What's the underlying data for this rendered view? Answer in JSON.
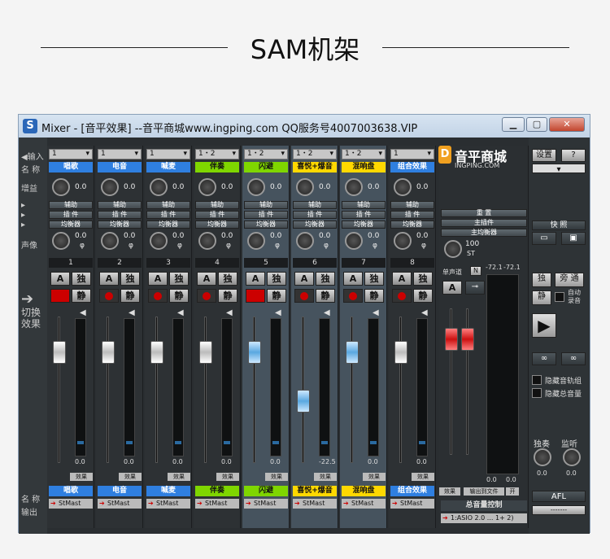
{
  "page": {
    "title": "SAM机架"
  },
  "window": {
    "title": "Mixer - [音平效果] --音平商城www.ingping.com QQ服务号4007003638.VIP",
    "app_icon": "S",
    "btn_min": "▁",
    "btn_max": "▢",
    "btn_close": "✕"
  },
  "rows": {
    "input": "◀输入",
    "name": "名 称",
    "gain": "增益",
    "pan": "声像",
    "switch_fx": "切换\n效果",
    "bottom_name": "名 称",
    "output": "输出"
  },
  "channels": [
    {
      "num": "1",
      "input": "1",
      "name": "唱歌",
      "name_color": "#2f7fe0",
      "gain": "0.0",
      "pan": "0.0",
      "pan_side": "φ",
      "fader_val": "0.0",
      "rec_on": true,
      "cap": "white",
      "out": "StMast"
    },
    {
      "num": "2",
      "input": "1",
      "name": "电音",
      "name_color": "#2f7fe0",
      "gain": "0.0",
      "pan": "0.0",
      "pan_side": "φ",
      "fader_val": "0.0",
      "rec_on": false,
      "cap": "white",
      "out": "StMast"
    },
    {
      "num": "3",
      "input": "1",
      "name": "喊麦",
      "name_color": "#2f7fe0",
      "gain": "0.0",
      "pan": "0.0",
      "pan_side": "φ",
      "fader_val": "0.0",
      "rec_on": false,
      "cap": "white",
      "out": "StMast"
    },
    {
      "num": "4",
      "input": "1・2",
      "name": "伴奏",
      "name_color": "#7fd600",
      "gain": "0.0",
      "pan": "0.0",
      "pan_side": "φ",
      "fader_val": "0.0",
      "rec_on": false,
      "cap": "white",
      "out": "StMast"
    },
    {
      "num": "5",
      "input": "1・2",
      "name": "闪避",
      "name_color": "#7fd600",
      "gain": "0.0",
      "pan": "0.0",
      "pan_side": "φ",
      "fader_val": "0.0",
      "rec_on": true,
      "cap": "blue",
      "out": "StMast"
    },
    {
      "num": "6",
      "input": "1・2",
      "name": "喜悦+爆音",
      "name_color": "#ffd800",
      "gain": "0.0",
      "pan": "0.0",
      "pan_side": "φ",
      "fader_val": "-22.5",
      "rec_on": false,
      "cap": "blue",
      "out": "StMast"
    },
    {
      "num": "7",
      "input": "1・2",
      "name": "混响盘",
      "name_color": "#ffd800",
      "gain": "0.0",
      "pan": "0.0",
      "pan_side": "φ",
      "fader_val": "0.0",
      "rec_on": false,
      "cap": "blue",
      "out": "StMast"
    },
    {
      "num": "8",
      "input": "1",
      "name": "组合效果",
      "name_color": "#2f7fe0",
      "gain": "0.0",
      "pan": "0.0",
      "pan_side": "φ",
      "fader_val": "0.0",
      "rec_on": false,
      "cap": "white",
      "out": "StMast"
    }
  ],
  "strip_buttons": {
    "aux": "辅助",
    "insert": "插 件",
    "eq": "均衡器",
    "a": "A",
    "solo": "独",
    "mute": "静",
    "fx": "效果"
  },
  "master": {
    "pan": "100",
    "pan_side": "ST",
    "num": "单声道",
    "n_btn": "N",
    "peak_l": "-72.1",
    "peak_r": "-72.1",
    "aux": "重 置",
    "insert": "主插件",
    "eq": "主均衡器",
    "quick": "快 照",
    "val_l": "0.0",
    "val_r": "0.0",
    "name": "总音量控制",
    "out": "1:ASIO 2.0 ... 1+ 2)",
    "fx": "效果",
    "export": "输出到文件",
    "export2": "开"
  },
  "logo": {
    "text": "音平商城",
    "sub": "INGPING.COM"
  },
  "right_panel": {
    "settings": "设置",
    "help": "?",
    "solo": "独",
    "bypass": "旁 通",
    "mute": "静",
    "auto_rec": "自动\n录音",
    "hide_tracks": "隐藏音轨组",
    "hide_master": "隐藏总音量",
    "solo_label": "独奏",
    "monitor_label": "监听",
    "solo_val": "0.0",
    "monitor_val": "0.0",
    "afl": "AFL",
    "bottom_sel": "-------"
  },
  "colors": {
    "accent_blue": "#2f7fe0",
    "accent_green": "#7fd600",
    "accent_yellow": "#ffd800",
    "rec_red": "#cc0000"
  }
}
